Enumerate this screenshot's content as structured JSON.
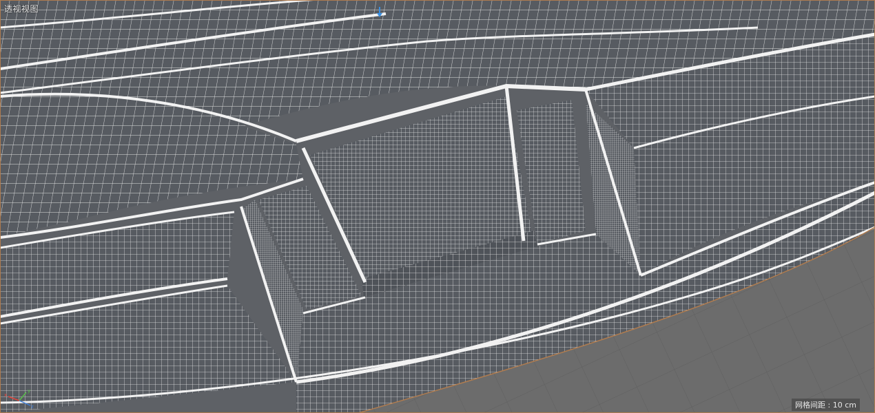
{
  "viewport": {
    "view_name": "透视视图",
    "grid_spacing_label": "网格间距 : 10 cm"
  },
  "colors": {
    "wire": "#e6e6e6",
    "surface": "#575b61",
    "floor": "#6a6a6a",
    "floor_grid": "#5a5a5a",
    "frame": "#b07c4f",
    "axis_x": "#e0443a",
    "axis_y": "#58c04a",
    "axis_z": "#3f7fd9",
    "camera_marker": "#3a8fe0"
  },
  "icons": {
    "axis_gizmo": "xyz-axis-icon",
    "camera_marker": "camera-target-icon"
  }
}
